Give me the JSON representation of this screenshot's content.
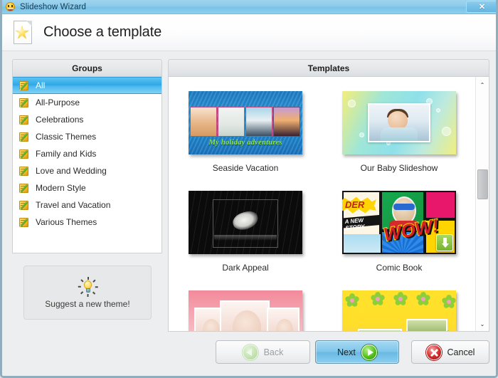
{
  "window": {
    "title": "Slideshow Wizard",
    "titlebar_icon": "app-smiley-icon",
    "close_label": "✕",
    "border_color": "#8fadbd",
    "titlebar_color": "#8ccbeb"
  },
  "header": {
    "icon": "star-document-icon",
    "title": "Choose a template"
  },
  "groups_panel": {
    "header": "Groups",
    "item_icon": "note-pencil-icon",
    "selected_index": 0,
    "selection_color": "#2ca7e8",
    "items": [
      {
        "label": "All",
        "selected": true
      },
      {
        "label": "All-Purpose",
        "selected": false
      },
      {
        "label": "Celebrations",
        "selected": false
      },
      {
        "label": "Classic Themes",
        "selected": false
      },
      {
        "label": "Family and Kids",
        "selected": false
      },
      {
        "label": "Love and Wedding",
        "selected": false
      },
      {
        "label": "Modern Style",
        "selected": false
      },
      {
        "label": "Travel and Vacation",
        "selected": false
      },
      {
        "label": "Various Themes",
        "selected": false
      }
    ]
  },
  "suggest_box": {
    "icon": "lightbulb-icon",
    "label": "Suggest a new theme!"
  },
  "templates_panel": {
    "header": "Templates",
    "items": [
      {
        "name": "Seaside Vacation",
        "art": "t-seaside",
        "caption": "My holiday adventures",
        "has_download_badge": false
      },
      {
        "name": "Our Baby Slideshow",
        "art": "t-baby",
        "caption": "",
        "has_download_badge": false
      },
      {
        "name": "Dark Appeal",
        "art": "t-dark",
        "caption": "",
        "has_download_badge": false
      },
      {
        "name": "Comic Book",
        "art": "t-comic",
        "caption": "WOW!",
        "comic_text_1": "DER",
        "comic_text_2": "A NEW STORY",
        "has_download_badge": true
      },
      {
        "name": "",
        "art": "t-pink",
        "caption": "",
        "has_download_badge": false
      },
      {
        "name": "",
        "art": "t-yellow",
        "caption": "",
        "has_download_badge": false
      }
    ],
    "scrollbar": {
      "up_arrow": "⌃",
      "down_arrow": "⌄",
      "thumb_position_pct": 40
    }
  },
  "footer": {
    "buttons": [
      {
        "key": "back",
        "label": "Back",
        "icon": "arrow-left-circle-icon",
        "enabled": false
      },
      {
        "key": "next",
        "label": "Next",
        "icon": "arrow-right-circle-icon",
        "enabled": true
      },
      {
        "key": "cancel",
        "label": "Cancel",
        "icon": "x-circle-icon",
        "enabled": true
      }
    ]
  }
}
